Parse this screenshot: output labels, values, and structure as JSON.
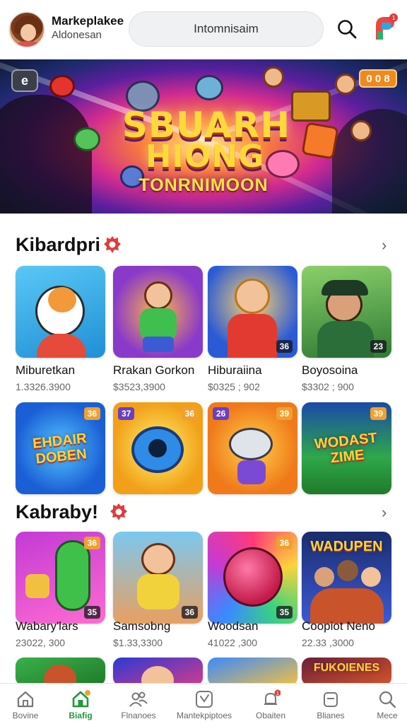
{
  "header": {
    "user_name": "Markeplakee",
    "user_sub": "Aldonesan",
    "search_placeholder": "Intomnisaim"
  },
  "banner": {
    "badge_left": "e",
    "badge_right": "0 0 8",
    "title_line1": "SBUARH",
    "title_line2": "HIONG",
    "subtitle": "TONRNIMOON"
  },
  "sections": [
    {
      "title": "Kibardpri",
      "rows": [
        [
          {
            "name": "Miburetkan",
            "price": "1.3326.3900",
            "num": "",
            "tag": ""
          },
          {
            "name": "Rrakan Gorkon",
            "price": "$3523,3900",
            "num": "",
            "tag": ""
          },
          {
            "name": "Hiburaiina",
            "price": "$0325 ; 902",
            "num": "36",
            "tag": ""
          },
          {
            "name": "Boyosoina",
            "price": "$3302 ; 900",
            "num": "23",
            "tag": ""
          }
        ],
        [
          {
            "name": "",
            "price": "",
            "tagl": "",
            "tag": "36",
            "art": "EHDAIR DOBEN"
          },
          {
            "name": "",
            "price": "",
            "tagl": "37",
            "tag": "36"
          },
          {
            "name": "",
            "price": "",
            "tagl": "26",
            "tag": "39"
          },
          {
            "name": "",
            "price": "",
            "tagl": "",
            "tag": "39",
            "art": "WODAST ZIME"
          }
        ]
      ]
    },
    {
      "title": "Kabraby!",
      "rows": [
        [
          {
            "name": "Wabary'lars",
            "price": "23022, 300",
            "num": "35",
            "tag": "36"
          },
          {
            "name": "Samsobng",
            "price": "$1.33,3300",
            "num": "36",
            "tag": ""
          },
          {
            "name": "Woodsan",
            "price": "41022 ,300",
            "num": "35",
            "tag": "36"
          },
          {
            "name": "Coopiot Neno",
            "price": "22.33 ,3000",
            "num": "",
            "tag": "",
            "art": "WADUPEN"
          }
        ],
        [
          {
            "name": "",
            "price": "",
            "tag": ""
          },
          {
            "name": "",
            "price": "",
            "tag": ""
          },
          {
            "name": "",
            "price": "",
            "tag": ""
          },
          {
            "name": "",
            "price": "",
            "tag": "",
            "art": "FUKOIENES"
          }
        ]
      ]
    }
  ],
  "nav": [
    {
      "label": "Bovine",
      "icon": "home-outline-icon"
    },
    {
      "label": "Biafig",
      "icon": "home-filled-icon",
      "active": true
    },
    {
      "label": "Flnanoes",
      "icon": "people-icon"
    },
    {
      "label": "Mantekpiptoes",
      "icon": "compass-icon"
    },
    {
      "label": "Obaiten",
      "icon": "bell-icon"
    },
    {
      "label": "Blianes",
      "icon": "bag-icon"
    },
    {
      "label": "Mece",
      "icon": "search-icon"
    }
  ],
  "colors": {
    "accent": "#1e9a3a",
    "tag_orange": "#f0a030",
    "tag_purple": "#6a3fc0",
    "badge_red": "#e03c3c"
  }
}
